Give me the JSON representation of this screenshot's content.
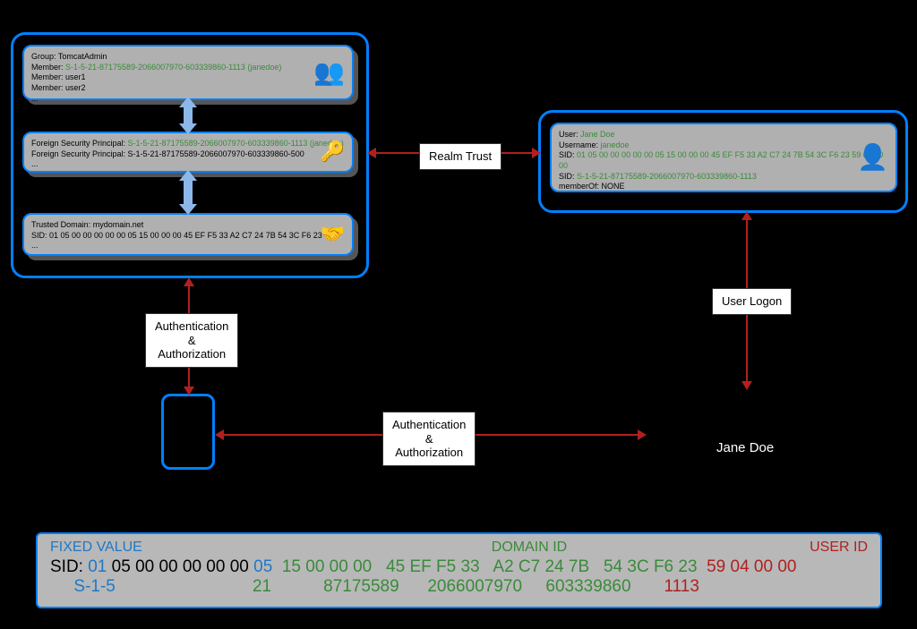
{
  "left": {
    "group": {
      "l1": "Group: TomcatAdmin",
      "l2a": "Member: ",
      "l2b": "S-1-5-21-87175589-2066007970-603339860-1113 (janedoe)",
      "l3": "Member: user1",
      "l4": "Member: user2",
      "l5": "..."
    },
    "fsp": {
      "l1a": "Foreign Security Principal: ",
      "l1b": "S-1-5-21-87175589-2066007970-603339860-1113 (janedoe)",
      "l2": "Foreign Security Principal: S-1-5-21-87175589-2066007970-603339860-500",
      "l3": "..."
    },
    "trust": {
      "l1": "Trusted Domain: mydomain.net",
      "l2": "SID: 01 05 00 00 00 00 00 05 15 00 00 00 45 EF F5 33 A2 C7 24 7B 54 3C F6 23",
      "l3": "..."
    }
  },
  "right": {
    "user": {
      "l1a": "User: ",
      "l1b": "Jane Doe",
      "l2a": "Username: ",
      "l2b": "janedoe",
      "l3a": "SID: ",
      "l3b": "01 05 00 00 00 00 00 05 15 00 00 00 45 EF F5 33 A2 C7 24 7B 54 3C F6 23 59 04 00 00",
      "l4a": "SID: ",
      "l4b": "S-1-5-21-87175589-2066007970-603339860-1113",
      "l5": "memberOf: NONE"
    }
  },
  "labels": {
    "realm": "Realm Trust",
    "auth": "Authentication\n&\nAuthorization",
    "logon": "User Logon",
    "jane": "Jane Doe"
  },
  "sid": {
    "h1": "FIXED VALUE",
    "h2": "DOMAIN ID",
    "h3": "USER ID",
    "r1": {
      "p": "SID: ",
      "a": "01 ",
      "b": "05 00 00 00 00 00 ",
      "c": "05  ",
      "d": "15 00 00 00   45 EF F5 33   A2 C7 24 7B   54 3C F6 23  ",
      "e": "59 04 00 00"
    },
    "r2": {
      "a": "     S-1-5",
      "b": "                             21           87175589      2066007970     603339860",
      "c": "       1113"
    }
  }
}
